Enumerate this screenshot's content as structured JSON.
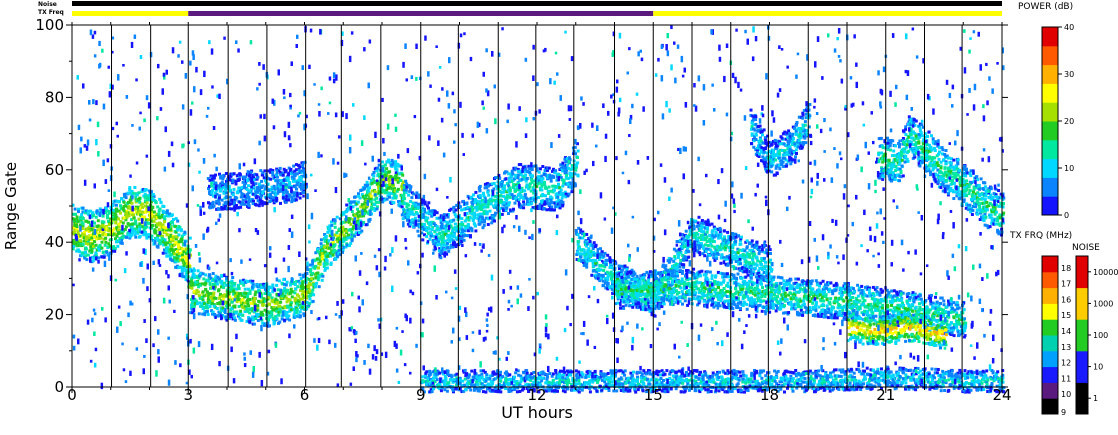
{
  "chart_data": {
    "type": "heatmap",
    "xlabel": "UT hours",
    "ylabel": "Range Gate",
    "xlim": [
      0,
      24
    ],
    "ylim": [
      0,
      100
    ],
    "x_ticks": [
      "0",
      "3",
      "6",
      "9",
      "12",
      "15",
      "18",
      "21",
      "24"
    ],
    "y_ticks": [
      "0",
      "20",
      "40",
      "60",
      "80",
      "100"
    ],
    "top_bars": {
      "noise_label": "Noise",
      "txfreq_label": "TX Freq",
      "txfreq_segments": [
        {
          "from": 0,
          "to": 3,
          "color": "#ffff00"
        },
        {
          "from": 3,
          "to": 15,
          "color": "#5a1a7e"
        },
        {
          "from": 15,
          "to": 24,
          "color": "#ffff00"
        }
      ]
    },
    "power_colorbar": {
      "title": "POWER (dB)",
      "ticks": [
        "0",
        "10",
        "20",
        "30",
        "40"
      ],
      "range": [
        0,
        40
      ],
      "colors": [
        "#1414ff",
        "#0a84ff",
        "#00d8ff",
        "#00e8a0",
        "#22cc22",
        "#a6e000",
        "#ffff00",
        "#ffb000",
        "#ff5a00",
        "#e00000"
      ]
    },
    "freq_colorbar": {
      "title": "TX FRQ (MHz)",
      "ticks": [
        "9",
        "10",
        "11",
        "12",
        "13",
        "14",
        "15",
        "16",
        "17",
        "18"
      ],
      "colors": [
        "#000000",
        "#5a1a7e",
        "#1a1aff",
        "#00a0ff",
        "#00d0b0",
        "#22cc22",
        "#ffff00",
        "#ffb000",
        "#ff5a00",
        "#e00000"
      ]
    },
    "noise_colorbar": {
      "title": "NOISE",
      "ticks": [
        "1",
        "10",
        "100",
        "1000",
        "10000"
      ],
      "colors": [
        "#000000",
        "#1a1aff",
        "#22cc22",
        "#ffcc00",
        "#e00000"
      ]
    },
    "scan_boundaries_hours": [
      1.02,
      2.03,
      3.0,
      4.03,
      5.03,
      6.03,
      6.95,
      7.97,
      9.0,
      9.97,
      11.0,
      11.97,
      12.95,
      14.0,
      15.0,
      16.0,
      17.0,
      17.97,
      19.0,
      20.0,
      21.0,
      22.0,
      22.97,
      24.0
    ],
    "backscatter_tracks": [
      {
        "x": [
          0.0,
          0.5,
          1.0,
          1.5,
          2.0,
          2.5,
          3.0
        ],
        "y": [
          44,
          42,
          44,
          49,
          48,
          42,
          35
        ],
        "width": 7,
        "power": 22
      },
      {
        "x": [
          3.0,
          4.0,
          5.0,
          6.0,
          6.5,
          7.5,
          8.0,
          8.5
        ],
        "y": [
          27,
          25,
          23,
          26,
          38,
          50,
          58,
          56
        ],
        "width": 6,
        "power": 20
      },
      {
        "x": [
          8.5,
          9.5,
          10.5,
          11.5,
          12.5,
          13.0
        ],
        "y": [
          52,
          42,
          50,
          56,
          55,
          62
        ],
        "width": 6,
        "power": 12
      },
      {
        "x": [
          13.0,
          14.0,
          15.0,
          16.0,
          17.0,
          18.0
        ],
        "y": [
          40,
          30,
          25,
          43,
          38,
          34
        ],
        "width": 5,
        "power": 12
      },
      {
        "x": [
          14.0,
          16.0,
          18.0,
          20.0,
          22.0,
          23.0
        ],
        "y": [
          27,
          28,
          26,
          24,
          21,
          19
        ],
        "width": 5,
        "power": 14
      },
      {
        "x": [
          20.0,
          20.5,
          21.0,
          21.5,
          22.0,
          22.5
        ],
        "y": [
          17,
          16,
          16,
          17,
          16,
          15
        ],
        "width": 4,
        "power": 26
      },
      {
        "x": [
          17.5,
          18.0,
          18.5,
          19.0
        ],
        "y": [
          72,
          63,
          67,
          74
        ],
        "width": 5,
        "power": 10
      },
      {
        "x": [
          20.8,
          21.3,
          21.6,
          22.0,
          22.5,
          23.0,
          23.5,
          24.0
        ],
        "y": [
          64,
          62,
          70,
          66,
          60,
          56,
          51,
          48
        ],
        "width": 6,
        "power": 14
      },
      {
        "x": [
          3.5,
          4.5,
          5.5,
          6.0
        ],
        "y": [
          54,
          55,
          56,
          58
        ],
        "width": 5,
        "power": 8
      },
      {
        "x": [
          9.0,
          11.0,
          13.0,
          15.0,
          17.0,
          19.0,
          21.0,
          23.0,
          24.0
        ],
        "y": [
          2,
          2,
          2,
          2,
          2,
          2,
          3,
          2,
          2
        ],
        "width": 3,
        "power": 10
      }
    ]
  }
}
